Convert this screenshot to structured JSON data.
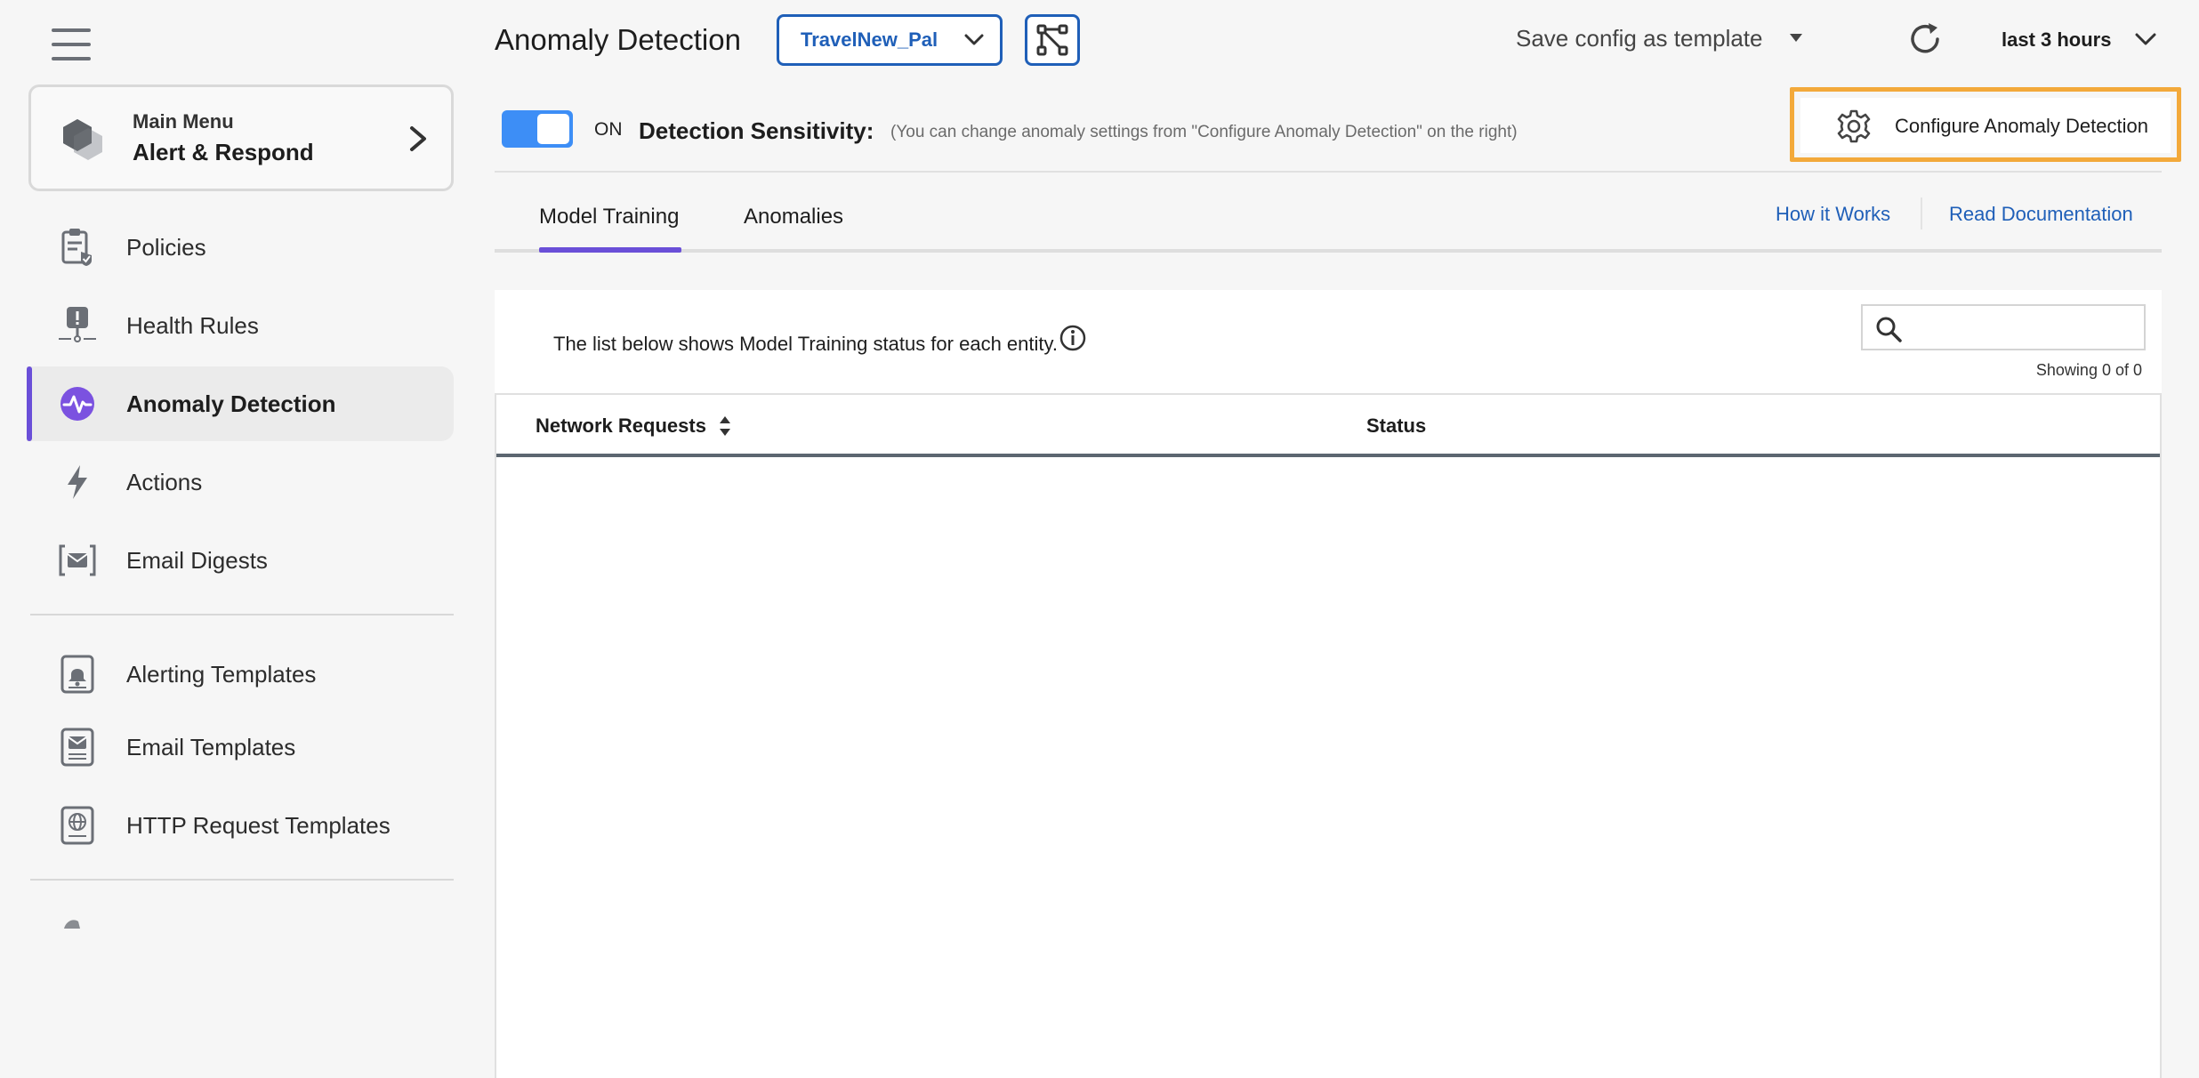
{
  "sidebar": {
    "main_menu": {
      "subtitle": "Main Menu",
      "title": "Alert & Respond"
    },
    "items": [
      {
        "label": "Policies",
        "icon": "policies-icon"
      },
      {
        "label": "Health Rules",
        "icon": "health-rules-icon"
      },
      {
        "label": "Anomaly Detection",
        "icon": "anomaly-detection-icon",
        "active": true
      },
      {
        "label": "Actions",
        "icon": "actions-icon"
      },
      {
        "label": "Email Digests",
        "icon": "email-digests-icon"
      }
    ],
    "templates": [
      {
        "label": "Alerting Templates",
        "icon": "alerting-templates-icon"
      },
      {
        "label": "Email Templates",
        "icon": "email-templates-icon"
      },
      {
        "label": "HTTP Request Templates",
        "icon": "http-request-templates-icon"
      }
    ]
  },
  "header": {
    "title": "Anomaly Detection",
    "app_select": "TravelNew_Pal",
    "save_template": "Save config as template",
    "time_range": "last 3 hours"
  },
  "detection": {
    "toggle_state": "ON",
    "sensitivity_label": "Detection Sensitivity:",
    "hint": "(You can change anomaly settings from \"Configure Anomaly Detection\" on the right)",
    "configure_button": "Configure Anomaly Detection"
  },
  "tabs": [
    {
      "label": "Model Training",
      "active": true
    },
    {
      "label": "Anomalies",
      "active": false
    }
  ],
  "links": {
    "how_it_works": "How it Works",
    "read_docs": "Read Documentation"
  },
  "panel": {
    "info": "The list below shows Model Training status for each entity.",
    "search_placeholder": "",
    "showing": "Showing 0 of 0",
    "columns": [
      "Network Requests",
      "Status"
    ],
    "rows": []
  },
  "colors": {
    "accent": "#6a4fd8",
    "link": "#1f5fb8",
    "toggle": "#3d8ef6",
    "highlight": "#f3a93a"
  }
}
